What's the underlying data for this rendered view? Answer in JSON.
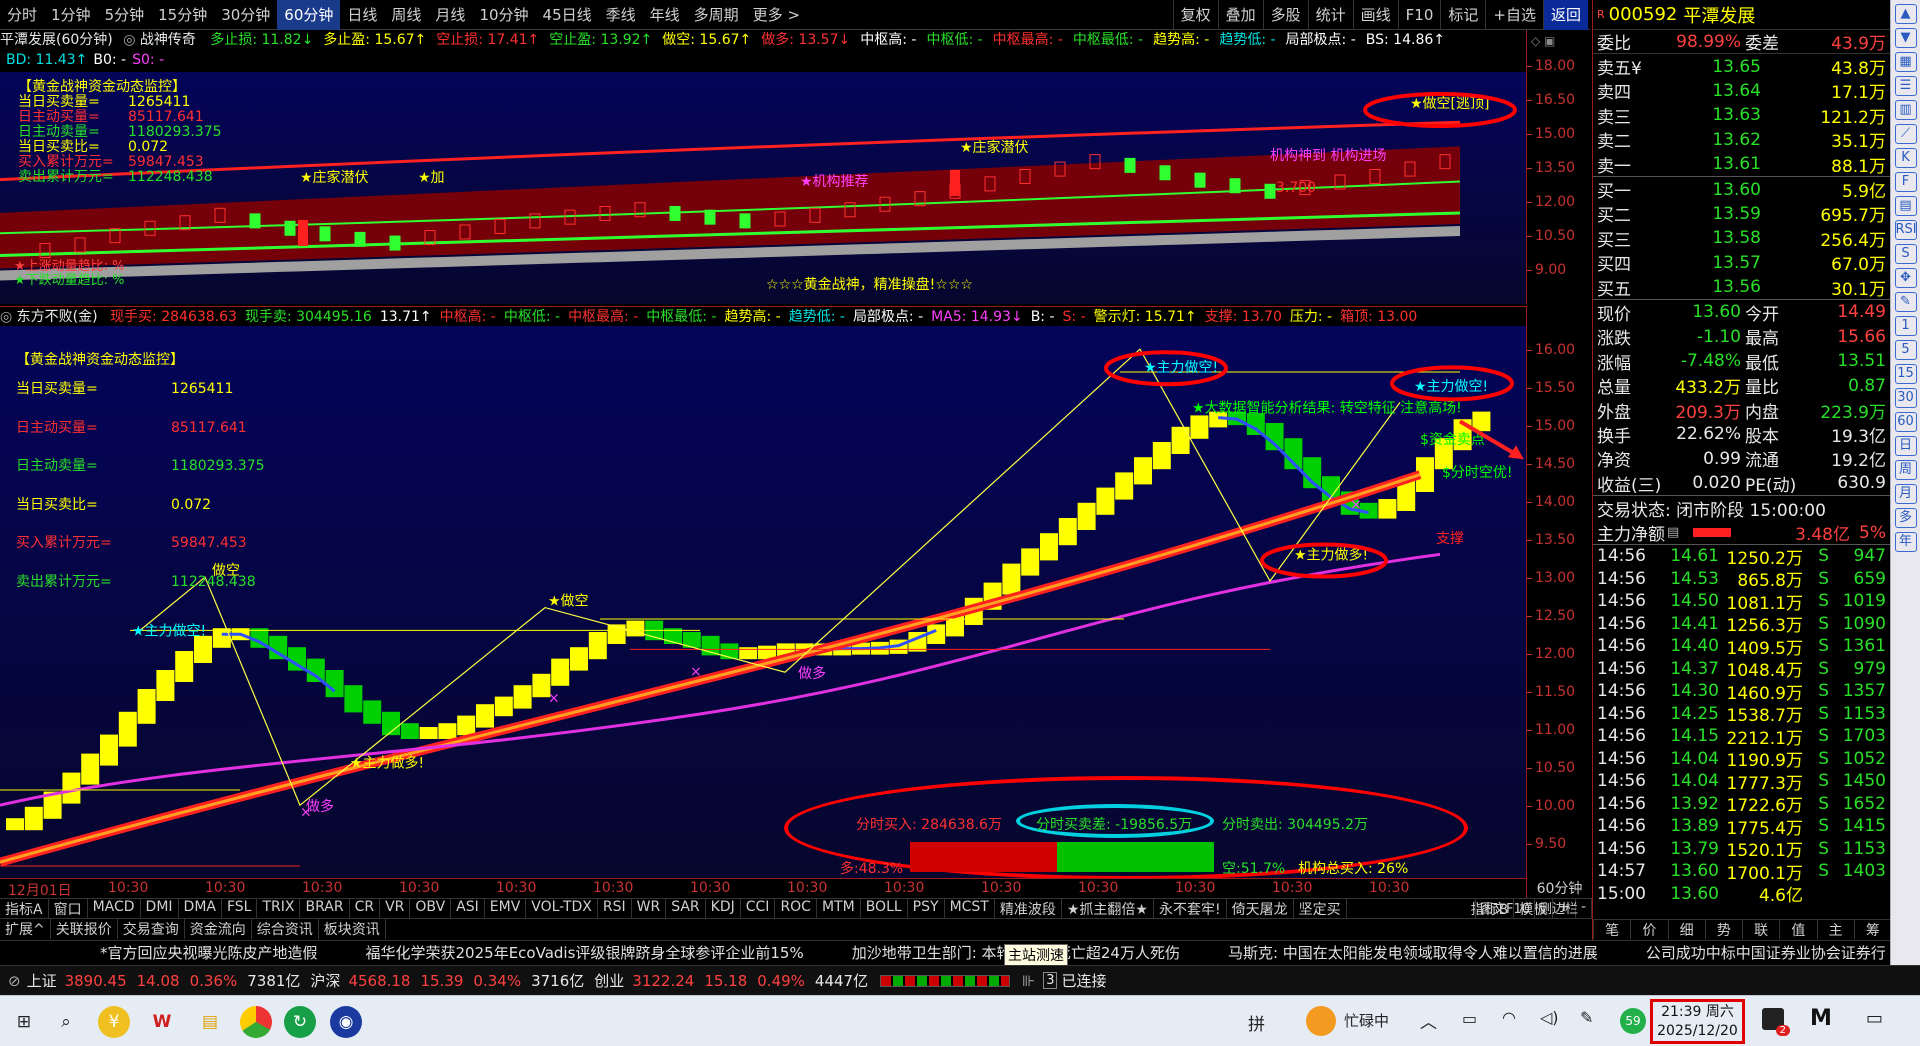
{
  "period_bar": {
    "periods": [
      "分时",
      "1分钟",
      "5分钟",
      "15分钟",
      "30分钟",
      "60分钟",
      "日线",
      "周线",
      "月线",
      "10分钟",
      "45日线",
      "季线",
      "年线",
      "多周期",
      "更多 >"
    ],
    "active": "60分钟",
    "tools": [
      "复权",
      "叠加",
      "多股",
      "统计",
      "画线",
      "F10",
      "标记",
      "+自选",
      "返回"
    ]
  },
  "stock": {
    "code_prefix": "R",
    "code": "000592",
    "name": "平潭发展"
  },
  "upper_panel": {
    "title": "平潭发展(60分钟)",
    "indicator_name": "战神传奇",
    "header_items": [
      {
        "text": "多止损: 11.82↓",
        "color": "#28e028"
      },
      {
        "text": "多止盈: 15.67↑",
        "color": "#ffff00"
      },
      {
        "text": "空止损: 17.41↑",
        "color": "#ff3030"
      },
      {
        "text": "空止盈: 13.92↑",
        "color": "#28e028"
      },
      {
        "text": "做空: 15.67↑",
        "color": "#ffff00"
      },
      {
        "text": "做多: 13.57↓",
        "color": "#ff3030"
      },
      {
        "text": "中枢高: -",
        "color": "#ffffff"
      },
      {
        "text": "中枢低: -",
        "color": "#28e028"
      },
      {
        "text": "中枢最高: -",
        "color": "#ff3030"
      },
      {
        "text": "中枢最低: -",
        "color": "#28e028"
      },
      {
        "text": "趋势高: -",
        "color": "#ffff00"
      },
      {
        "text": "趋势低: -",
        "color": "#00e0e0"
      },
      {
        "text": "局部极点: -",
        "color": "#ffffff"
      },
      {
        "text": "BS: 14.86↑",
        "color": "#ffffff"
      }
    ],
    "header2": [
      {
        "text": "BD: 11.43↑",
        "color": "#00e0e0"
      },
      {
        "text": "B0: -",
        "color": "#ffffff"
      },
      {
        "text": "S0: -",
        "color": "#ff40ff"
      }
    ],
    "monitor_title": "【黄金战神资金动态监控】",
    "monitor_lines": [
      {
        "label": "当日买卖量=",
        "value": "1265411",
        "color": "#ffff00"
      },
      {
        "label": "日主动买量=",
        "value": "85117.641",
        "color": "#ff3030"
      },
      {
        "label": "日主动卖量=",
        "value": "1180293.375",
        "color": "#28e028"
      },
      {
        "label": "当日买卖比=",
        "value": "0.072",
        "color": "#ffff00"
      },
      {
        "label": "买入累计万元=",
        "value": "59847.453",
        "color": "#ff3030"
      },
      {
        "label": "卖出累计万元=",
        "value": "112248.438",
        "color": "#28e028"
      }
    ],
    "bottom_lines": [
      "★上涨动量趋比: %",
      "★下跌动量趋比: %"
    ],
    "slogan": "☆☆☆黄金战神，精准操盘!☆☆☆",
    "labels": [
      {
        "text": "★庄家潜伏",
        "color": "#ffff00"
      },
      {
        "text": "★庄家潜伏",
        "color": "#ffff00"
      },
      {
        "text": "★机构推荐",
        "color": "#ff40ff"
      },
      {
        "text": "★加",
        "color": "#ffff00"
      },
      {
        "text": "机构神到 机构进场",
        "color": "#ff40ff"
      },
      {
        "text": "★做空[逃顶]",
        "color": "#ffff00"
      },
      {
        "text": "3.700",
        "color": "#ff3030"
      }
    ],
    "axis": [
      "18.00",
      "16.50",
      "15.00",
      "13.50",
      "12.00",
      "10.50",
      "9.00"
    ]
  },
  "lower_panel": {
    "indicator_name": "东方不败(金)",
    "header_items": [
      {
        "text": "现手买: 284638.63",
        "color": "#ff3030"
      },
      {
        "text": "现手卖: 304495.16",
        "color": "#28e028"
      },
      {
        "text": "13.71↑",
        "color": "#ffffff"
      },
      {
        "text": "中枢高: -",
        "color": "#ff3030"
      },
      {
        "text": "中枢低: -",
        "color": "#28e028"
      },
      {
        "text": "中枢最高: -",
        "color": "#ff3030"
      },
      {
        "text": "中枢最低: -",
        "color": "#28e028"
      },
      {
        "text": "趋势高: -",
        "color": "#ffff00"
      },
      {
        "text": "趋势低: -",
        "color": "#00e0e0"
      },
      {
        "text": "局部极点: -",
        "color": "#ffffff"
      },
      {
        "text": "MA5: 14.93↓",
        "color": "#ff40ff"
      },
      {
        "text": "B: -",
        "color": "#ffffff"
      },
      {
        "text": "S: -",
        "color": "#ff3030"
      },
      {
        "text": "警示灯: 15.71↑",
        "color": "#ffff00"
      },
      {
        "text": "支撑: 13.70",
        "color": "#ff3030"
      },
      {
        "text": "压力: -",
        "color": "#ffff00"
      },
      {
        "text": "箱顶: 13.00",
        "color": "#ff3030"
      }
    ],
    "monitor_title": "【黄金战神资金动态监控】",
    "monitor_lines": [
      {
        "label": "当日买卖量=",
        "value": "1265411",
        "color": "#ffff00"
      },
      {
        "label": "日主动买量=",
        "value": "85117.641",
        "color": "#ff3030"
      },
      {
        "label": "日主动卖量=",
        "value": "1180293.375",
        "color": "#28e028"
      },
      {
        "label": "当日买卖比=",
        "value": "0.072",
        "color": "#ffff00"
      },
      {
        "label": "买入累计万元=",
        "value": "59847.453",
        "color": "#ff3030"
      },
      {
        "label": "卖出累计万元=",
        "value": "112248.438",
        "color": "#28e028"
      }
    ],
    "signals": {
      "zhuli_zuokong_1": "★主力做空!",
      "zuokong_1": "做空",
      "zuokong_2": "★做空",
      "zhuli_zuoduo_1": "★主力做多!",
      "zuoduo_1": "做多",
      "zuoduo_2": "做多",
      "zuokong_top": "★主力做空!",
      "zhuli_zuokong_2": "★主力做空!",
      "zhuli_zuoduo_2": "★主力做多!",
      "bigdata": "★大数据智能分析结果: 转空特征 注意高场!",
      "gold_sell": "$资金卖点",
      "fenshi_kong": "$分时空优!",
      "support": "支撑"
    },
    "summary": {
      "buy_label": "分时买入: 284638.6万",
      "diff_label": "分时买卖差: -19856.5万",
      "sell_label": "分时卖出: 304495.2万",
      "long_pct": "多:48.3%",
      "short_pct": "空:51.7%",
      "inst_label": "机构总买入: 26%",
      "long_fraction": 0.483
    },
    "axis": [
      "16.00",
      "15.50",
      "15.00",
      "14.50",
      "14.00",
      "13.50",
      "13.00",
      "12.50",
      "12.00",
      "11.50",
      "11.00",
      "10.50",
      "10.00",
      "9.50"
    ]
  },
  "x_axis": {
    "labels": [
      "12月01日",
      "10:30",
      "10:30",
      "10:30",
      "10:30",
      "10:30",
      "10:30",
      "10:30",
      "10:30",
      "10:30",
      "10:30",
      "10:30",
      "10:30",
      "10:30",
      "10:30"
    ],
    "period_tag": "60分钟"
  },
  "indicator_tabs": [
    "指标A",
    "窗口",
    "MACD",
    "DMI",
    "DMA",
    "FSL",
    "TRIX",
    "BRAR",
    "CR",
    "VR",
    "OBV",
    "ASI",
    "EMV",
    "VOL-TDX",
    "RSI",
    "WR",
    "SAR",
    "KDJ",
    "CCI",
    "ROC",
    "MTM",
    "BOLL",
    "PSY",
    "MCST",
    "精准波段",
    "★抓主翻倍★",
    "永不套牢!",
    "倚天屠龙",
    "坚定买"
  ],
  "indicator_tabs_right": [
    "指标B",
    "模板",
    "+",
    "-"
  ],
  "bottom_tabs": [
    "扩展^",
    "关联报价",
    "交易查询",
    "资金流向",
    "综合资讯",
    "板块资讯"
  ],
  "news_ticker": [
    "*官方回应央视曝光陈皮产地造假",
    "福华化学荣获2025年EcoVadis评级银牌跻身全球参评企业前15%",
    "加沙地带卫生部门: 本轮冲突...死亡超24万人死伤",
    "马斯克: 中国在太阳能发电领域取得令人难以置信的进展",
    "公司成功中标中国证券业协会证券行"
  ],
  "ticker_popup": "主站测速",
  "status_bar": {
    "index1_name": "上证",
    "index1_val": "3890.45",
    "index1_chg": "14.08",
    "index1_pct": "0.36%",
    "index1_amt": "7381亿",
    "index2_name": "沪深",
    "index2_val": "4568.18",
    "index2_chg": "15.39",
    "index2_pct": "0.34%",
    "index2_amt": "3716亿",
    "index3_name": "创业",
    "index3_val": "3122.24",
    "index3_chg": "15.18",
    "index3_pct": "0.49%",
    "index3_amt": "4447亿",
    "conn": "已连接",
    "conn_num": "3"
  },
  "quote": {
    "weibi_label": "委比",
    "weibi": "98.99%",
    "weicha_label": "委差",
    "weicha": "43.9万",
    "asks": [
      {
        "label": "卖五¥",
        "price": "13.65",
        "vol": "43.8万"
      },
      {
        "label": "卖四",
        "price": "13.64",
        "vol": "17.1万"
      },
      {
        "label": "卖三",
        "price": "13.63",
        "vol": "121.2万"
      },
      {
        "label": "卖二",
        "price": "13.62",
        "vol": "35.1万"
      },
      {
        "label": "卖一",
        "price": "13.61",
        "vol": "88.1万"
      }
    ],
    "bids": [
      {
        "label": "买一",
        "price": "13.60",
        "vol": "5.9亿"
      },
      {
        "label": "买二",
        "price": "13.59",
        "vol": "695.7万"
      },
      {
        "label": "买三",
        "price": "13.58",
        "vol": "256.4万"
      },
      {
        "label": "买四",
        "price": "13.57",
        "vol": "67.0万"
      },
      {
        "label": "买五",
        "price": "13.56",
        "vol": "30.1万"
      }
    ],
    "stats": [
      {
        "l1": "现价",
        "v1": "13.60",
        "c1": "#28e028",
        "l2": "今开",
        "v2": "14.49",
        "c2": "#ff4040"
      },
      {
        "l1": "涨跌",
        "v1": "-1.10",
        "c1": "#28e028",
        "l2": "最高",
        "v2": "15.66",
        "c2": "#ff4040"
      },
      {
        "l1": "涨幅",
        "v1": "-7.48%",
        "c1": "#28e028",
        "l2": "最低",
        "v2": "13.51",
        "c2": "#28e028"
      },
      {
        "l1": "总量",
        "v1": "433.2万",
        "c1": "#ffff00",
        "l2": "量比",
        "v2": "0.87",
        "c2": "#28e028"
      },
      {
        "l1": "外盘",
        "v1": "209.3万",
        "c1": "#ff4040",
        "l2": "内盘",
        "v2": "223.9万",
        "c2": "#28e028"
      },
      {
        "l1": "换手",
        "v1": "22.62%",
        "c1": "#e8e8e8",
        "l2": "股本",
        "v2": "19.3亿",
        "c2": "#e8e8e8"
      },
      {
        "l1": "净资",
        "v1": "0.99",
        "c1": "#e8e8e8",
        "l2": "流通",
        "v2": "19.2亿",
        "c2": "#e8e8e8"
      },
      {
        "l1": "收益(三)",
        "v1": "0.020",
        "c1": "#e8e8e8",
        "l2": "PE(动)",
        "v2": "630.9",
        "c2": "#e8e8e8"
      }
    ],
    "trade_state": "交易状态: 闭市阶段 15:00:00",
    "main_net_label": "主力净额",
    "main_net_value": "3.48亿",
    "main_net_pct": "5%",
    "ticks": [
      {
        "time": "14:56",
        "price": "14.61",
        "amt": "1250.2万",
        "flag": "S",
        "vol": "947"
      },
      {
        "time": "14:56",
        "price": "14.53",
        "amt": "865.8万",
        "flag": "S",
        "vol": "659"
      },
      {
        "time": "14:56",
        "price": "14.50",
        "amt": "1081.1万",
        "flag": "S",
        "vol": "1019"
      },
      {
        "time": "14:56",
        "price": "14.41",
        "amt": "1256.3万",
        "flag": "S",
        "vol": "1090"
      },
      {
        "time": "14:56",
        "price": "14.40",
        "amt": "1409.5万",
        "flag": "S",
        "vol": "1361"
      },
      {
        "time": "14:56",
        "price": "14.37",
        "amt": "1048.4万",
        "flag": "S",
        "vol": "979"
      },
      {
        "time": "14:56",
        "price": "14.30",
        "amt": "1460.9万",
        "flag": "S",
        "vol": "1357"
      },
      {
        "time": "14:56",
        "price": "14.25",
        "amt": "1538.7万",
        "flag": "S",
        "vol": "1153"
      },
      {
        "time": "14:56",
        "price": "14.15",
        "amt": "2212.1万",
        "flag": "S",
        "vol": "1703"
      },
      {
        "time": "14:56",
        "price": "14.04",
        "amt": "1190.9万",
        "flag": "S",
        "vol": "1052"
      },
      {
        "time": "14:56",
        "price": "14.04",
        "amt": "1777.3万",
        "flag": "S",
        "vol": "1450"
      },
      {
        "time": "14:56",
        "price": "13.92",
        "amt": "1722.6万",
        "flag": "S",
        "vol": "1652"
      },
      {
        "time": "14:56",
        "price": "13.89",
        "amt": "1775.4万",
        "flag": "S",
        "vol": "1415"
      },
      {
        "time": "14:56",
        "price": "13.79",
        "amt": "1520.1万",
        "flag": "S",
        "vol": "1153"
      },
      {
        "time": "14:57",
        "price": "13.60",
        "amt": "1700.1万",
        "flag": "S",
        "vol": "1403"
      },
      {
        "time": "15:00",
        "price": "13.60",
        "amt": "4.6亿",
        "flag": "",
        "vol": ""
      }
    ],
    "bottom_tabs": [
      "笔",
      "价",
      "细",
      "势",
      "联",
      "值",
      "主",
      "筹"
    ],
    "f10_tabs": [
      "图文F10",
      "侧边栏"
    ]
  },
  "sidebar_icons": [
    "up-arrow",
    "down-arrow",
    "grid",
    "list",
    "chart",
    "line",
    "K",
    "F",
    "table",
    "RSI",
    "S",
    "move",
    "pen",
    "1",
    "5",
    "15",
    "30",
    "60",
    "日",
    "周",
    "月",
    "多",
    "年"
  ],
  "taskbar": {
    "ime": "拼",
    "weather": "忙碌中",
    "time": "21:39 周六",
    "date": "2025/12/20",
    "notif_badge": "2",
    "temp_badge": "59"
  }
}
